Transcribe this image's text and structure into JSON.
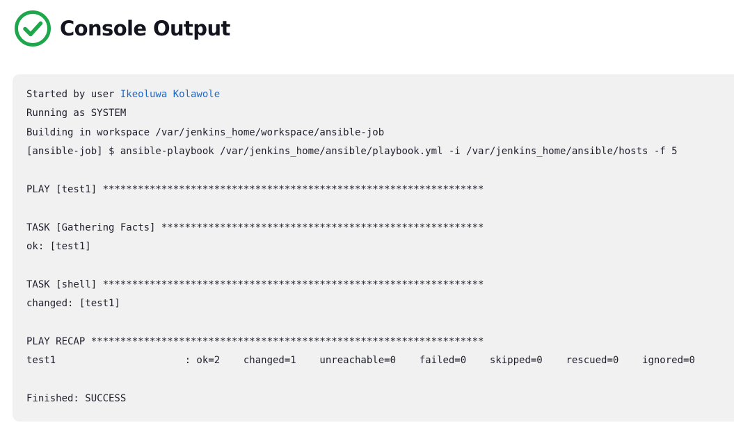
{
  "header": {
    "title": "Console Output",
    "status_icon": "success-check-icon",
    "status_color": "#1ea64b"
  },
  "console": {
    "started_prefix": "Started by user ",
    "user_link": "Ikeoluwa Kolawole",
    "link_color": "#1c68c8",
    "lines": [
      "Running as SYSTEM",
      "Building in workspace /var/jenkins_home/workspace/ansible-job",
      "[ansible-job] $ ansible-playbook /var/jenkins_home/ansible/playbook.yml -i /var/jenkins_home/ansible/hosts -f 5",
      "",
      "PLAY [test1] *****************************************************************",
      "",
      "TASK [Gathering Facts] *******************************************************",
      "ok: [test1]",
      "",
      "TASK [shell] *****************************************************************",
      "changed: [test1]",
      "",
      "PLAY RECAP *******************************************************************",
      "test1                      : ok=2    changed=1    unreachable=0    failed=0    skipped=0    rescued=0    ignored=0",
      "",
      "Finished: SUCCESS"
    ]
  }
}
